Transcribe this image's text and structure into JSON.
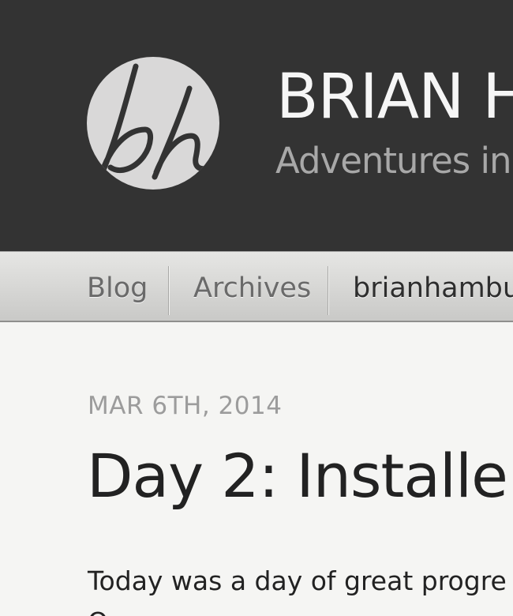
{
  "header": {
    "title": "BRIAN H",
    "subtitle": "Adventures in",
    "logo_text": "bh"
  },
  "nav": {
    "items": [
      {
        "label": "Blog"
      },
      {
        "label": "Archives"
      },
      {
        "label": "brianhambu"
      }
    ]
  },
  "post": {
    "date": "MAR 6TH, 2014",
    "title": "Day 2: Installe",
    "body_line1": "Today was a day of great progre",
    "body_line2": "O"
  },
  "colors": {
    "header_bg": "#333333",
    "logo_bg": "#d9d8d8",
    "title": "#f6f6f6",
    "subtitle": "#a8a8a8",
    "nav_text": "#6a6a6a",
    "nav_active_text": "#2e2e2e",
    "date_text": "#9c9c9c",
    "body_text": "#222222"
  }
}
